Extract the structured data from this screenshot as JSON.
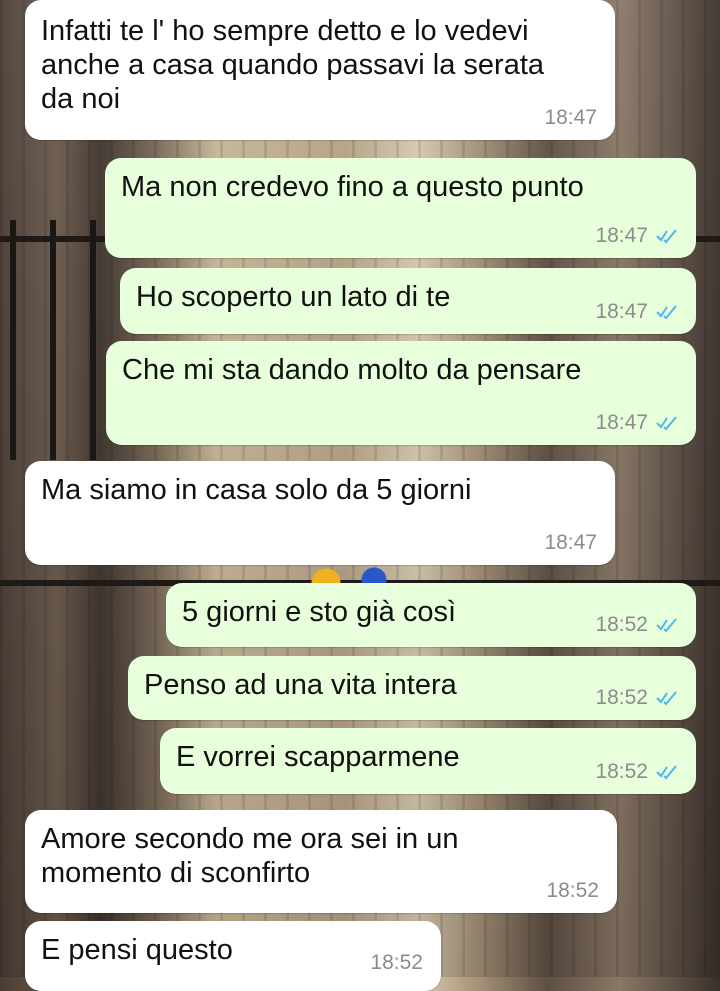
{
  "conversation": {
    "messages": [
      {
        "direction": "incoming",
        "text": "Infatti te l' ho sempre detto e lo vedevi\nanche a casa quando passavi la serata\nda noi",
        "time": "18:47"
      },
      {
        "direction": "outgoing",
        "text": "Ma non credevo fino a questo punto",
        "time": "18:47",
        "status": "read",
        "status_icon": "double-check-icon"
      },
      {
        "direction": "outgoing",
        "text": "Ho scoperto un lato di te",
        "time": "18:47",
        "status": "read",
        "status_icon": "double-check-icon"
      },
      {
        "direction": "outgoing",
        "text": "Che mi sta dando molto da pensare",
        "time": "18:47",
        "status": "read",
        "status_icon": "double-check-icon"
      },
      {
        "direction": "incoming",
        "text": "Ma siamo in casa solo da 5 giorni",
        "time": "18:47"
      },
      {
        "direction": "outgoing",
        "text": "5 giorni e sto già così",
        "time": "18:52",
        "status": "read",
        "status_icon": "double-check-icon"
      },
      {
        "direction": "outgoing",
        "text": "Penso ad una vita intera",
        "time": "18:52",
        "status": "read",
        "status_icon": "double-check-icon"
      },
      {
        "direction": "outgoing",
        "text": "E vorrei scapparmene",
        "time": "18:52",
        "status": "read",
        "status_icon": "double-check-icon"
      },
      {
        "direction": "incoming",
        "text": "Amore secondo me ora sei in un\nmomento di sconfirto",
        "time": "18:52"
      },
      {
        "direction": "incoming",
        "text": "E pensi questo",
        "time": "18:52"
      }
    ]
  },
  "colors": {
    "incoming_bubble": "#ffffff",
    "outgoing_bubble": "#e7ffdb",
    "read_ticks": "#4fb6ec",
    "timestamp": "#8c8c8c"
  }
}
